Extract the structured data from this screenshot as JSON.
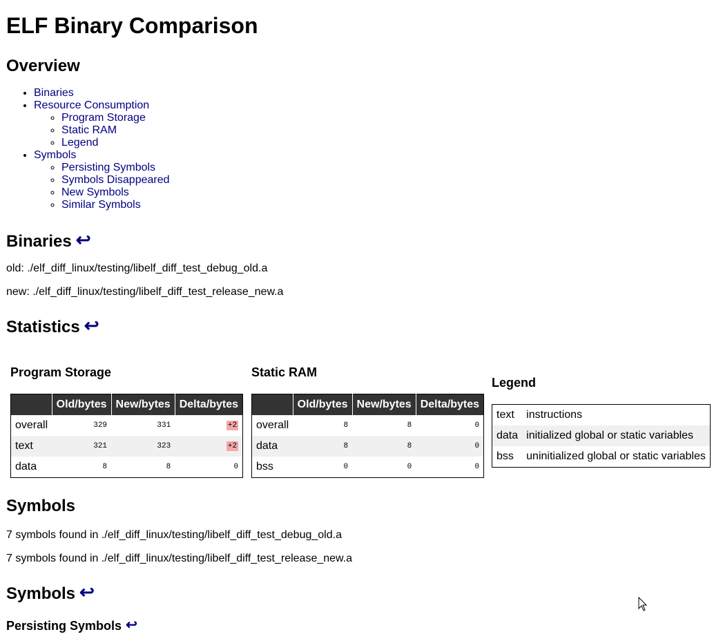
{
  "title": "ELF Binary Comparison",
  "overview": {
    "heading": "Overview",
    "toc": [
      {
        "label": "Binaries",
        "children": []
      },
      {
        "label": "Resource Consumption",
        "children": [
          "Program Storage",
          "Static RAM",
          "Legend"
        ]
      },
      {
        "label": "Symbols",
        "children": [
          "Persisting Symbols",
          "Symbols Disappeared",
          "New Symbols",
          "Similar Symbols"
        ]
      }
    ]
  },
  "binaries": {
    "heading": "Binaries",
    "old_line": "old: ./elf_diff_linux/testing/libelf_diff_test_debug_old.a",
    "new_line": "new: ./elf_diff_linux/testing/libelf_diff_test_release_new.a"
  },
  "statistics": {
    "heading": "Statistics",
    "program_storage": {
      "title": "Program Storage",
      "headers": [
        "",
        "Old/bytes",
        "New/bytes",
        "Delta/bytes"
      ],
      "rows": [
        [
          "overall",
          "329",
          "331",
          "+2"
        ],
        [
          "text",
          "321",
          "323",
          "+2"
        ],
        [
          "data",
          "8",
          "8",
          "0"
        ]
      ]
    },
    "static_ram": {
      "title": "Static RAM",
      "headers": [
        "",
        "Old/bytes",
        "New/bytes",
        "Delta/bytes"
      ],
      "rows": [
        [
          "overall",
          "8",
          "8",
          "0"
        ],
        [
          "data",
          "8",
          "8",
          "0"
        ],
        [
          "bss",
          "0",
          "0",
          "0"
        ]
      ]
    },
    "legend": {
      "title": "Legend",
      "rows": [
        [
          "text",
          "instructions"
        ],
        [
          "data",
          "initialized global or static variables"
        ],
        [
          "bss",
          "uninitialized global or static variables"
        ]
      ]
    }
  },
  "symbols_summary": {
    "heading": "Symbols",
    "old_line": "7 symbols found in ./elf_diff_linux/testing/libelf_diff_test_debug_old.a",
    "new_line": "7 symbols found in ./elf_diff_linux/testing/libelf_diff_test_release_new.a"
  },
  "symbols_section": {
    "heading": "Symbols",
    "persisting_heading": "Persisting Symbols"
  },
  "back_arrow": "↩",
  "colors": {
    "link": "#000080",
    "table_header_bg": "#333333",
    "positive_delta_bg": "#f4a8a8"
  }
}
